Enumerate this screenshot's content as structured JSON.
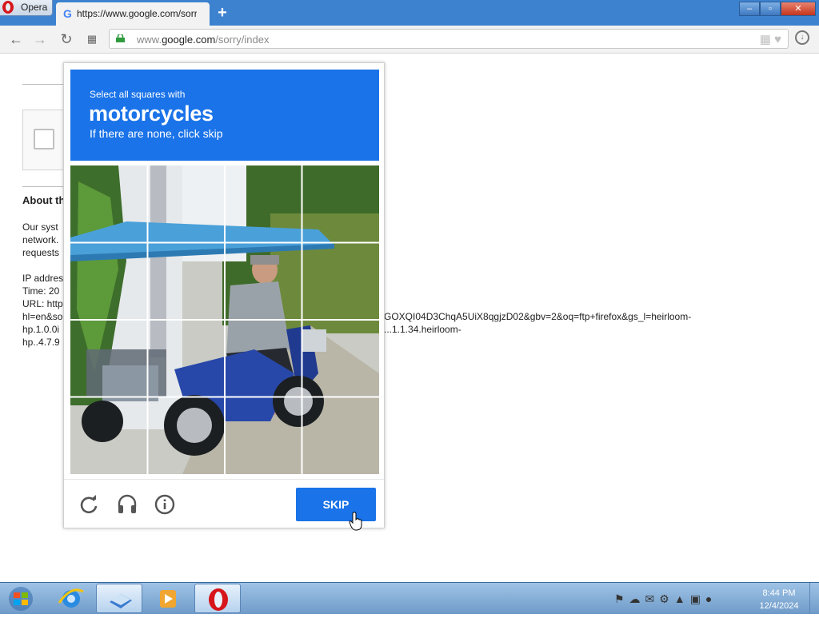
{
  "browser": {
    "menu_label": "Opera",
    "tab_title": "https://www.google.com/sorry/index",
    "new_tab_symbol": "+",
    "url_prefix": "www.",
    "url_domain": "google.com",
    "url_path": "/sorry/index",
    "window_controls": {
      "minimize": "–",
      "maximize": "▫",
      "close": "✕"
    }
  },
  "page": {
    "about_heading": "About th",
    "paragraph_lines": [
      "Our syst",
      "network.",
      "requests"
    ],
    "info_lines": [
      "IP addres",
      "Time: 20",
      "URL: http",
      "hl=en&so",
      "hp.1.0.0i",
      "hp..4.7.9"
    ],
    "url_tail_1": "GOXQI04D3ChqA5UiX8qgjzD02&gbv=2&oq=ftp+firefox&gs_l=heirloom-",
    "url_tail_2": "...1.1.34.heirloom-"
  },
  "captcha": {
    "instruction": "Select all squares with",
    "target": "motorcycles",
    "hint": "If there are none, click skip",
    "skip_label": "SKIP",
    "grid_size": 4
  },
  "taskbar": {
    "time": "8:44 PM",
    "date": "12/4/2024",
    "colors": {
      "accent": "#1a73e8",
      "titlebar": "#3d82cf"
    }
  }
}
